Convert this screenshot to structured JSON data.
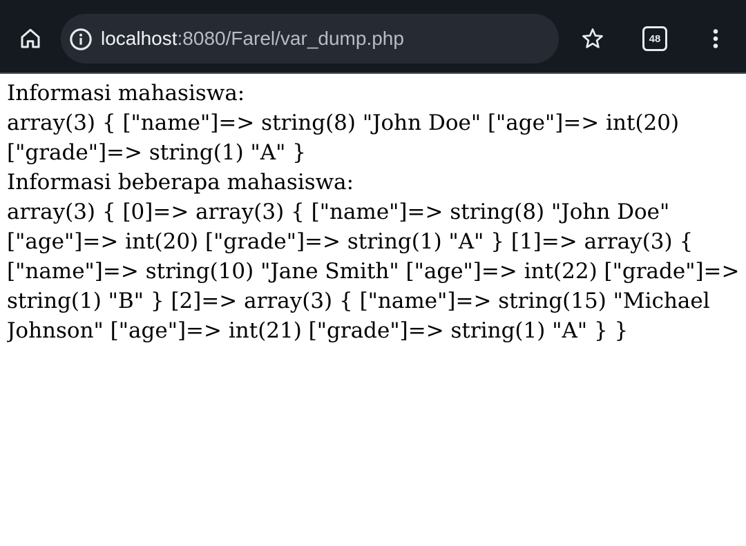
{
  "browser": {
    "url_host": "localhost",
    "url_path": ":8080/Farel/var_dump.php",
    "tab_count": "48",
    "icons": {
      "home": "home-icon",
      "info": "info-icon",
      "star": "star-icon",
      "tabs": "tab-switcher-icon",
      "menu": "more-vert-icon"
    }
  },
  "page": {
    "lines": [
      "Informasi mahasiswa:",
      "array(3) { [\"name\"]=> string(8) \"John Doe\" [\"age\"]=> int(20)",
      "[\"grade\"]=> string(1) \"A\" }",
      "Informasi beberapa mahasiswa:",
      "array(3) { [0]=> array(3) { [\"name\"]=> string(8) \"John Doe\"",
      "[\"age\"]=> int(20) [\"grade\"]=> string(1) \"A\" } [1]=> array(3) {",
      "[\"name\"]=> string(10) \"Jane Smith\" [\"age\"]=> int(22) [\"grade\"]=>",
      "string(1) \"B\" } [2]=> array(3) { [\"name\"]=> string(15) \"Michael",
      "Johnson\" [\"age\"]=> int(21) [\"grade\"]=> string(1) \"A\" } }"
    ]
  },
  "colors": {
    "toolbar_bg": "#151a21",
    "urlbar_bg": "#262b33",
    "icon": "#e8eaed",
    "page_bg": "#ffffff",
    "text": "#000000"
  }
}
